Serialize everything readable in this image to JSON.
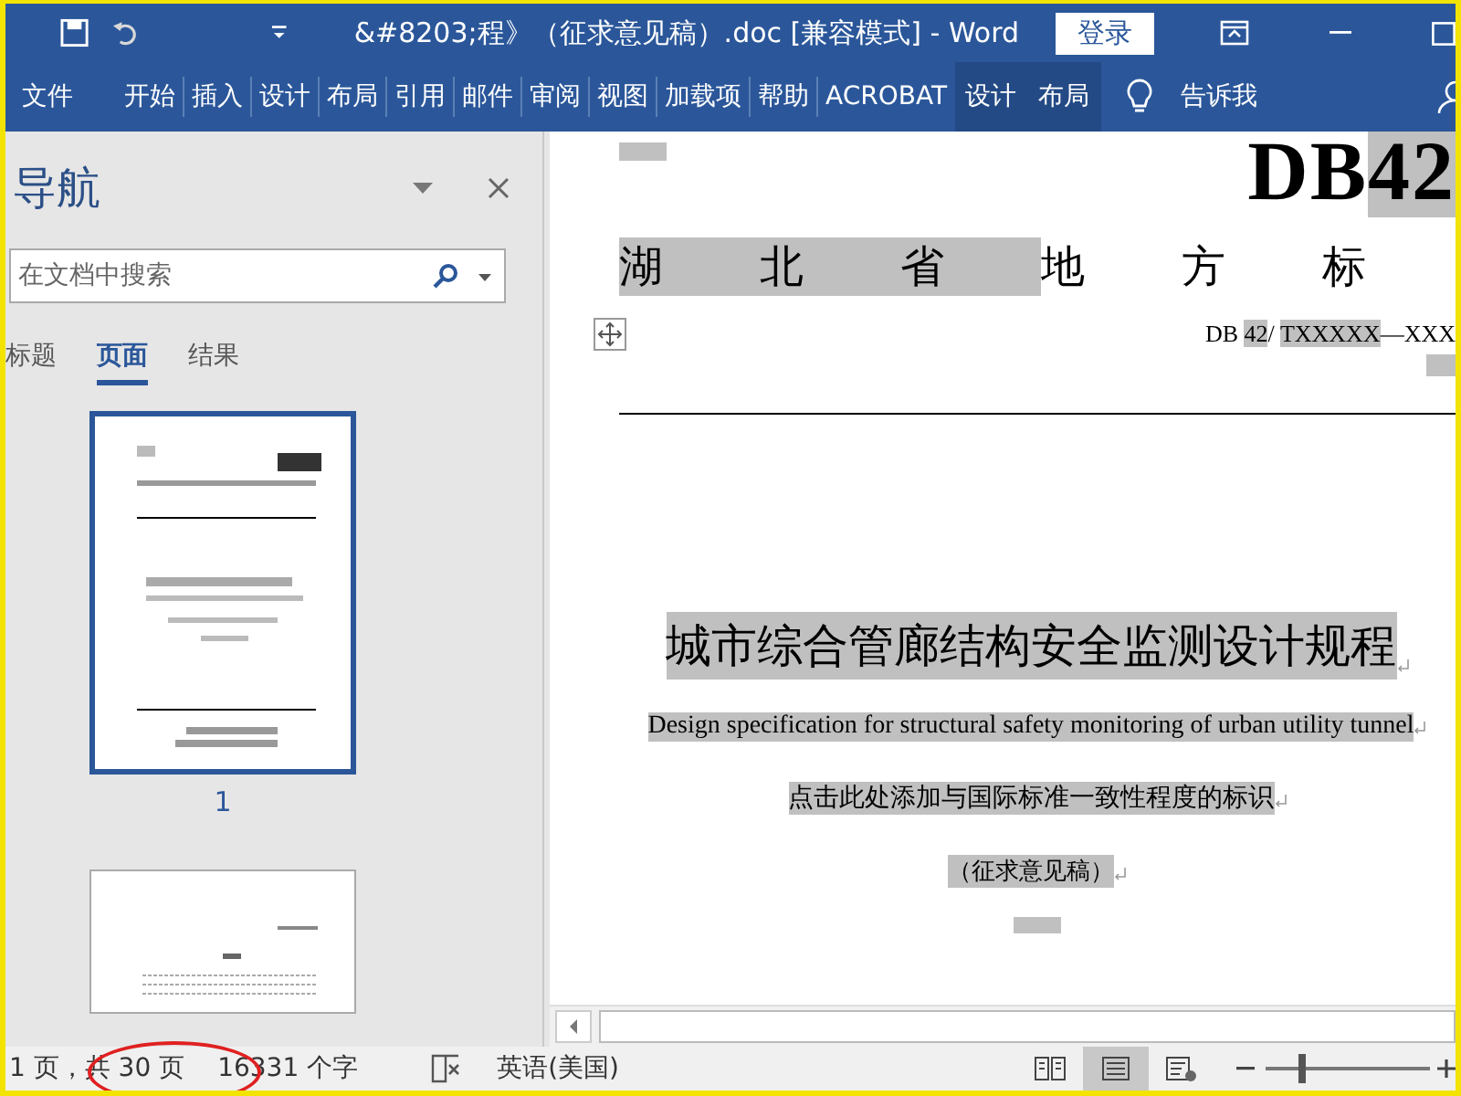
{
  "title_bar": {
    "title": "&#8203;程》（征求意见稿）.doc [兼容模式]  -  Word",
    "login_button": "登录"
  },
  "ribbon": {
    "tabs": [
      {
        "label": "文件",
        "kind": "file"
      },
      {
        "label": "开始",
        "kind": "normal"
      },
      {
        "label": "插入",
        "kind": "normal"
      },
      {
        "label": "设计",
        "kind": "normal"
      },
      {
        "label": "布局",
        "kind": "normal"
      },
      {
        "label": "引用",
        "kind": "normal"
      },
      {
        "label": "邮件",
        "kind": "normal"
      },
      {
        "label": "审阅",
        "kind": "normal"
      },
      {
        "label": "视图",
        "kind": "normal"
      },
      {
        "label": "加载项",
        "kind": "normal"
      },
      {
        "label": "帮助",
        "kind": "normal"
      },
      {
        "label": "ACROBAT",
        "kind": "normal"
      },
      {
        "label": "设计",
        "kind": "contextual"
      },
      {
        "label": "布局",
        "kind": "contextual"
      }
    ],
    "tell_me": "告诉我"
  },
  "navigation": {
    "title": "导航",
    "search": {
      "placeholder": "在文档中搜索"
    },
    "tabs": [
      {
        "label": "标题",
        "selected": false
      },
      {
        "label": "页面",
        "selected": true
      },
      {
        "label": "结果",
        "selected": false
      }
    ],
    "pages": [
      {
        "label": "1",
        "selected": true
      },
      {
        "selected": false
      }
    ]
  },
  "document": {
    "code": [
      {
        "text": "DB",
        "highlighted": false
      },
      {
        "text": "42",
        "highlighted": true
      }
    ],
    "heading_groups": [
      {
        "chars": [
          "湖",
          "北",
          "省"
        ],
        "highlighted": true
      },
      {
        "chars": [
          "地",
          "方",
          "标"
        ],
        "highlighted": false
      }
    ],
    "standard_number": [
      {
        "text": "DB ",
        "highlighted": false
      },
      {
        "text": "42",
        "highlighted": true
      },
      {
        "text": "/ ",
        "highlighted": false
      },
      {
        "text": "TXXXXX",
        "highlighted": true
      },
      {
        "text": "—XXX",
        "highlighted": false
      }
    ],
    "lines": [
      {
        "text": "城市综合管廊结构安全监测设计规程",
        "kind": "title"
      },
      {
        "text": "Design specification for structural safety monitoring of urban utility tunnel",
        "kind": "subtitle"
      },
      {
        "text": "点击此处添加与国际标准一致性程度的标识",
        "kind": "note"
      },
      {
        "text": "（征求意见稿）",
        "kind": "stage"
      }
    ]
  },
  "status_bar": {
    "page_count": "1 页，共 30 页",
    "word_count": "16331 个字",
    "language": "英语(美国)",
    "views": [
      {
        "kind": "read",
        "selected": false
      },
      {
        "kind": "print",
        "selected": true
      },
      {
        "kind": "web",
        "selected": false
      }
    ],
    "zoom": {
      "level": 0.2
    }
  }
}
